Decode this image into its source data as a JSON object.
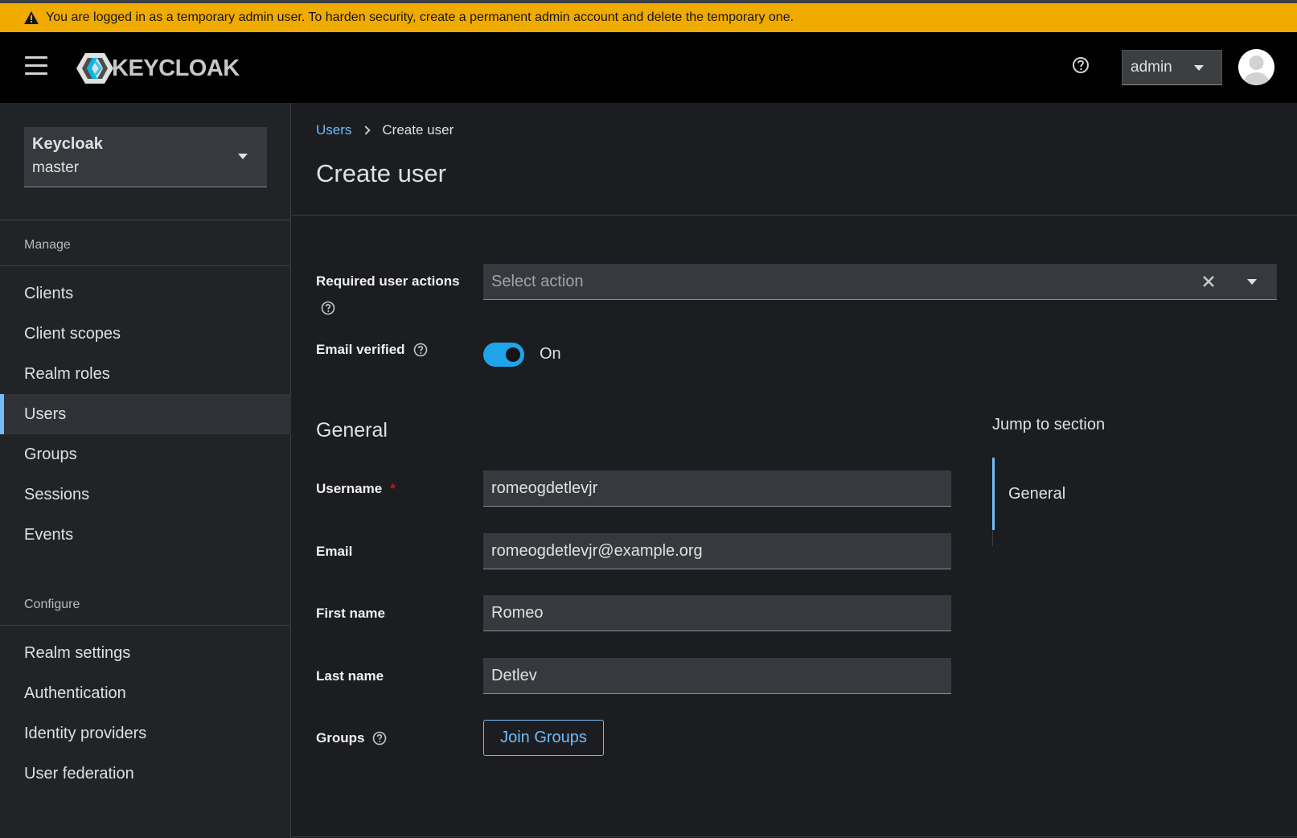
{
  "banner": {
    "message": "You are logged in as a temporary admin user. To harden security, create a permanent admin account and delete the temporary one.",
    "icon": "warning-triangle-icon",
    "color": "#f0ab00"
  },
  "header": {
    "logo_text": "KEYCLOAK",
    "user_menu_label": "admin"
  },
  "sidebar": {
    "realm": {
      "name": "Keycloak",
      "realm": "master"
    },
    "manage_title": "Manage",
    "manage_items": [
      "Clients",
      "Client scopes",
      "Realm roles",
      "Users",
      "Groups",
      "Sessions",
      "Events"
    ],
    "active_item": "Users",
    "configure_title": "Configure",
    "configure_items": [
      "Realm settings",
      "Authentication",
      "Identity providers",
      "User federation"
    ]
  },
  "main": {
    "breadcrumb": {
      "parent": "Users",
      "current": "Create user"
    },
    "title": "Create user",
    "required_actions": {
      "label": "Required user actions",
      "placeholder": "Select action"
    },
    "email_verified": {
      "label": "Email verified",
      "state": "On",
      "checked": true
    },
    "general_title": "General",
    "fields": {
      "username": {
        "label": "Username",
        "value": "romeogdetlevjr",
        "required_mark": "*"
      },
      "email": {
        "label": "Email",
        "value": "romeogdetlevjr@example.org"
      },
      "first_name": {
        "label": "First name",
        "value": "Romeo"
      },
      "last_name": {
        "label": "Last name",
        "value": "Detlev"
      }
    },
    "groups": {
      "label": "Groups",
      "button": "Join Groups"
    },
    "jump": {
      "title": "Jump to section",
      "items": [
        "General"
      ]
    }
  },
  "colors": {
    "accent": "#73bcf7",
    "toggle_on": "#1ea4e9",
    "required": "#c9190b",
    "background": "#1b1d21",
    "sidebar": "#212427"
  }
}
